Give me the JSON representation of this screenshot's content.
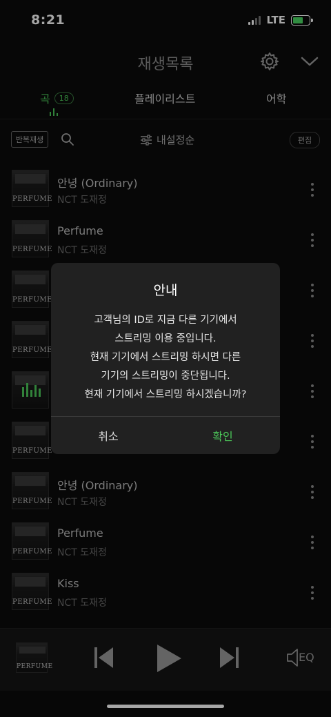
{
  "status_bar": {
    "time": "8:21",
    "network": "LTE",
    "battery_charging": true
  },
  "header": {
    "title": "재생목록",
    "settings_icon": "gear-icon",
    "collapse_icon": "chevron-down-icon"
  },
  "tabs": [
    {
      "label": "곡",
      "count": "18",
      "active": true
    },
    {
      "label": "플레이리스트",
      "active": false
    },
    {
      "label": "어학",
      "active": false
    }
  ],
  "toolbar": {
    "repeat_label": "반복재생",
    "sort_label": "내설정순",
    "edit_label": "편집"
  },
  "songs": [
    {
      "title": "안녕 (Ordinary)",
      "artist": "NCT 도재정",
      "album": "PERFUME"
    },
    {
      "title": "Perfume",
      "artist": "NCT 도재정",
      "album": "PERFUME"
    },
    {
      "title": "",
      "artist": "",
      "album": "PERFUME"
    },
    {
      "title": "",
      "artist": "",
      "album": "PERFUME"
    },
    {
      "title": "",
      "artist": "",
      "album": "",
      "playing": true
    },
    {
      "title": "",
      "artist": "",
      "album": "PERFUME"
    },
    {
      "title": "안녕 (Ordinary)",
      "artist": "NCT 도재정",
      "album": "PERFUME"
    },
    {
      "title": "Perfume",
      "artist": "NCT 도재정",
      "album": "PERFUME"
    },
    {
      "title": "Kiss",
      "artist": "NCT 도재정",
      "album": "PERFUME"
    }
  ],
  "dialog": {
    "title": "안내",
    "message_lines": [
      "고객님의 ID로 지금 다른 기기에서",
      "스트리밍 이용 중입니다.",
      "현재 기기에서 스트리밍 하시면 다른",
      "기기의 스트리밍이 중단됩니다.",
      "현재 기기에서 스트리밍 하시겠습니까?"
    ],
    "cancel_label": "취소",
    "confirm_label": "확인"
  },
  "player": {
    "album": "PERFUME",
    "eq_label": "EQ"
  },
  "colors": {
    "accent": "#4cc85a",
    "background": "#0b0b0b",
    "dialog": "#212121"
  }
}
